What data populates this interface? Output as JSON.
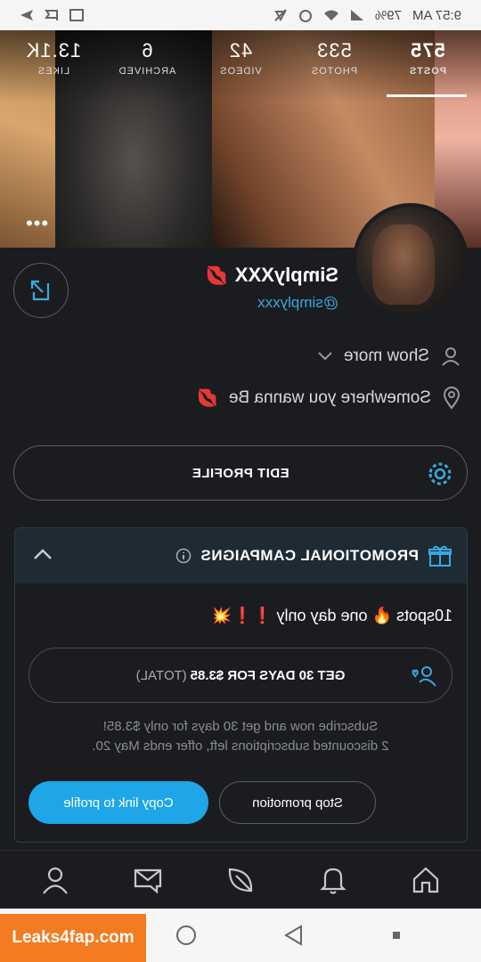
{
  "status_bar": {
    "time": "9:57 AM",
    "battery": "79%"
  },
  "stats": [
    {
      "value": "575",
      "label": "POSTS"
    },
    {
      "value": "533",
      "label": "PHOTOS"
    },
    {
      "value": "42",
      "label": "VIDEOS"
    },
    {
      "value": "6",
      "label": "ARCHIVED"
    },
    {
      "value": "13.1K",
      "label": "LIKES"
    }
  ],
  "cover_more": "•••",
  "profile": {
    "name": "SimplyXXX",
    "handle": "@simplyxxx",
    "show_more": "Show more",
    "location": "Somewhere you wanna Be"
  },
  "edit_profile_label": "EDIT PROFILE",
  "promo": {
    "title": "PROMOTIONAL CAMPAIGNS",
    "text": "10spots 🔥 one day only ❗❗💥",
    "offer_main": "GET 30 DAYS FOR",
    "offer_price": "$3.85",
    "offer_total": "(TOTAL)",
    "note_line1": "Subscribe now and get 30 days for only $3.85!",
    "note_line2": "2 discounted subscriptions left, offer ends May 20.",
    "copy_label": "Copy link to profile",
    "stop_label": "Stop promotion"
  },
  "watermark": "Leaks4fap.com",
  "colors": {
    "accent": "#1ea6e8",
    "background": "#1b1c1f",
    "header": "#1e2b35"
  }
}
